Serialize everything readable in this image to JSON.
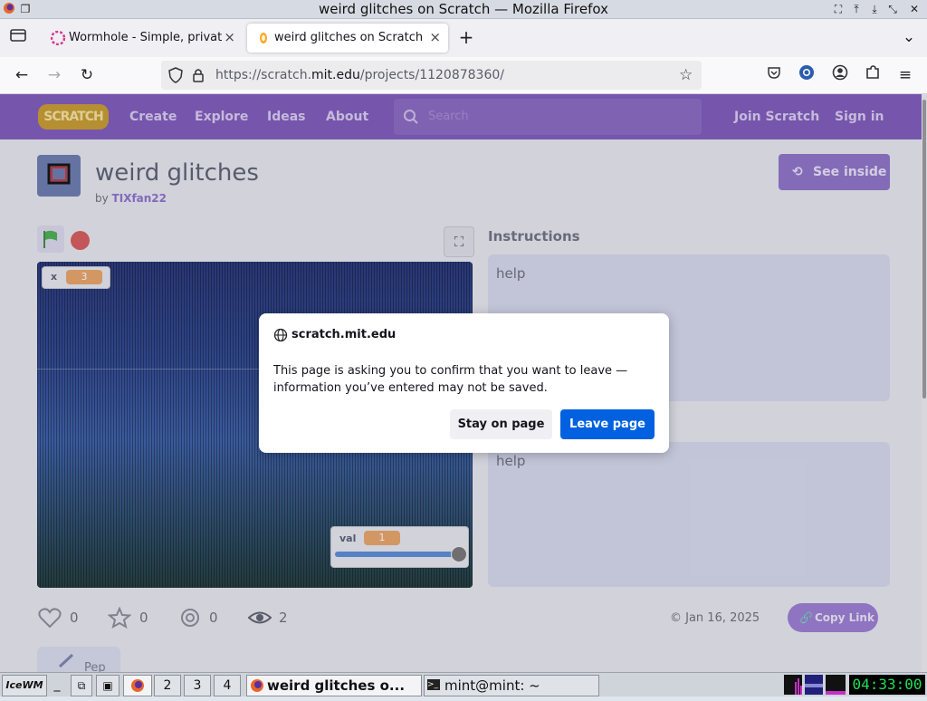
{
  "window": {
    "title": "weird glitches on Scratch — Mozilla Firefox"
  },
  "tabs": [
    {
      "label": "Wormhole - Simple, private",
      "active": false
    },
    {
      "label": "weird glitches on Scratch",
      "active": true
    }
  ],
  "navbar": {
    "url_prefix": "https://scratch.",
    "url_domain": "mit.edu",
    "url_path": "/projects/1120878360/"
  },
  "scratch_nav": {
    "logo": "SCRATCH",
    "links": [
      "Create",
      "Explore",
      "Ideas",
      "About"
    ],
    "search_placeholder": "Search",
    "join": "Join Scratch",
    "signin": "Sign in"
  },
  "project": {
    "title": "weird glitches",
    "by_prefix": "by",
    "author": "TIXfan22",
    "see_inside": "See inside",
    "var_x_label": "x",
    "var_x_value": "3",
    "var_val_label": "val",
    "var_val_value": "1",
    "slider_level": 1.0,
    "instructions_heading": "Instructions",
    "instructions_text": "help",
    "notes_text": "help",
    "stats": {
      "loves": "0",
      "favorites": "0",
      "remixes": "0",
      "views": "2"
    },
    "date": "© Jan 16, 2025",
    "copy_link": "Copy Link",
    "studio_label": "Pep"
  },
  "dialog": {
    "host": "scratch.mit.edu",
    "message": "This page is asking you to confirm that you want to leave — information you’ve entered may not be saved.",
    "stay": "Stay on page",
    "leave": "Leave page"
  },
  "taskbar": {
    "start": "IceWM",
    "workspaces": [
      "2",
      "3",
      "4"
    ],
    "task1": "weird glitches o...",
    "task2": "mint@mint: ~",
    "clock": "04:33:00"
  },
  "colors": {
    "scratch_purple": "#855cd6",
    "leave_blue": "#0061e0",
    "var_orange": "#f07f1a"
  }
}
